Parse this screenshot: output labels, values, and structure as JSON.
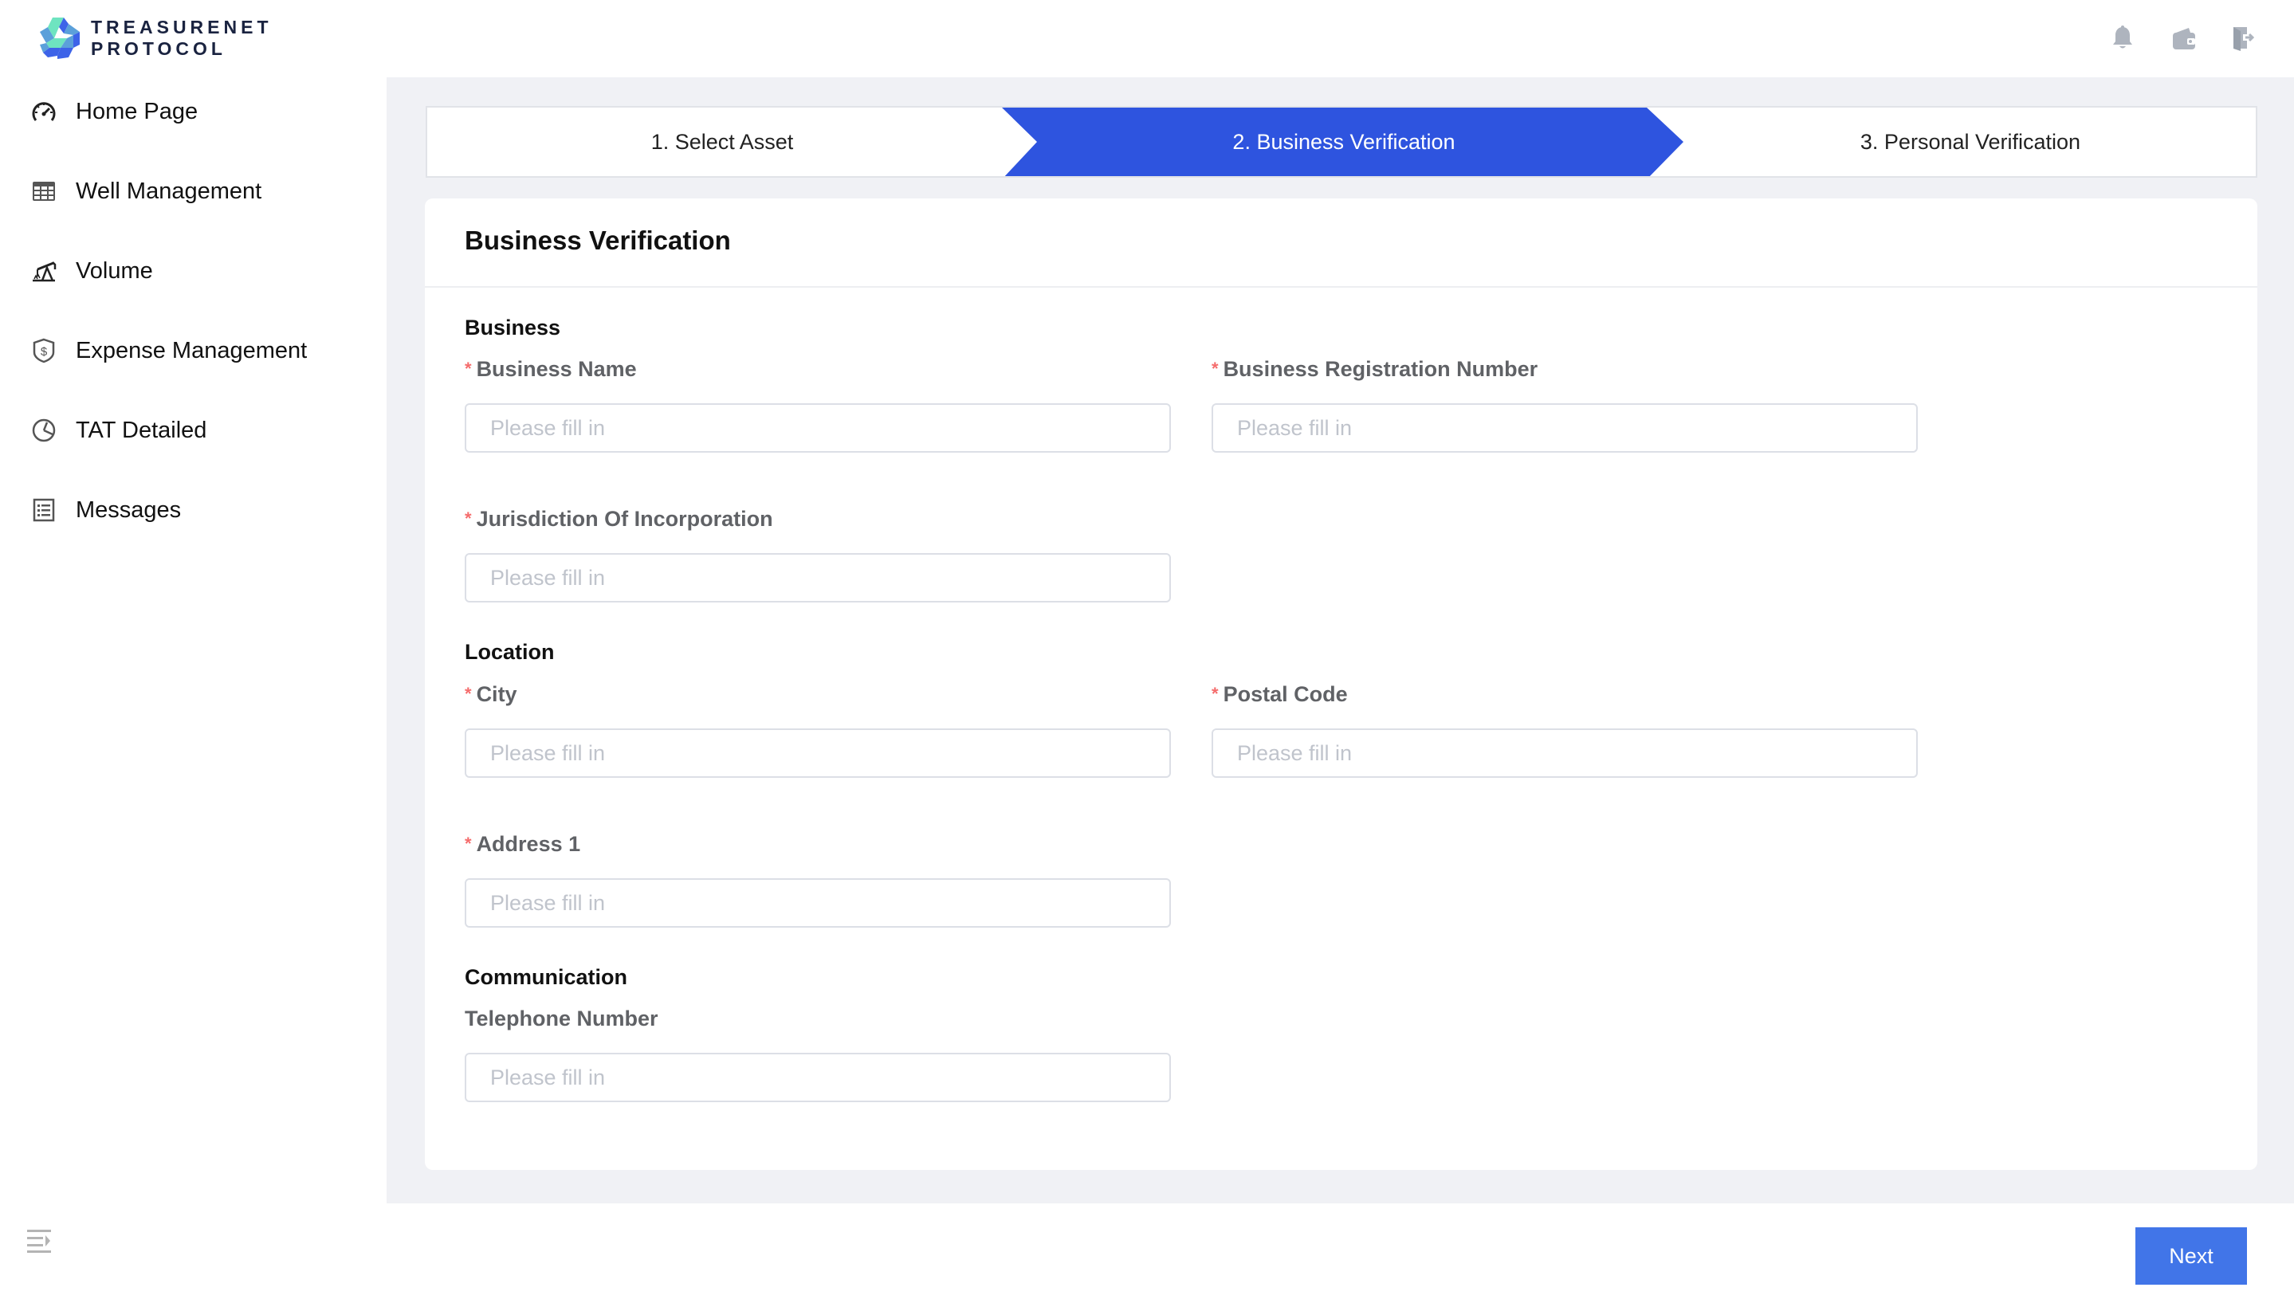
{
  "brand": {
    "line1": "TREASURENET",
    "line2": "PROTOCOL",
    "colors": {
      "teal": "#6EE4C0",
      "mid_blue": "#5BA0DA",
      "blue": "#3D63E8",
      "navy": "#1A2340"
    }
  },
  "header": {
    "icons": [
      {
        "name": "bell-icon"
      },
      {
        "name": "wallet-icon"
      },
      {
        "name": "logout-icon"
      }
    ]
  },
  "sidebar": {
    "items": [
      {
        "label": "Home Page",
        "icon": "dashboard-gauge-icon"
      },
      {
        "label": "Well Management",
        "icon": "table-grid-icon"
      },
      {
        "label": "Volume",
        "icon": "oil-pump-icon"
      },
      {
        "label": "Expense Management",
        "icon": "shield-dollar-icon"
      },
      {
        "label": "TAT Detailed",
        "icon": "pie-clock-icon"
      },
      {
        "label": "Messages",
        "icon": "list-document-icon"
      }
    ],
    "collapse_icon": "collapse-menu-icon"
  },
  "steps": {
    "items": [
      {
        "label": "1. Select Asset",
        "active": false
      },
      {
        "label": "2. Business Verification",
        "active": true
      },
      {
        "label": "3. Personal Verification",
        "active": false
      }
    ],
    "active_color": "#2E54DF"
  },
  "form": {
    "title": "Business Verification",
    "sections": {
      "business": "Business",
      "location": "Location",
      "communication": "Communication"
    },
    "fields": {
      "business_name": {
        "label": "Business Name",
        "required": "*",
        "placeholder": "Please fill in",
        "value": ""
      },
      "business_registration_number": {
        "label": "Business Registration Number",
        "required": "*",
        "placeholder": "Please fill in",
        "value": ""
      },
      "jurisdiction": {
        "label": "Jurisdiction Of Incorporation",
        "required": "*",
        "placeholder": "Please fill in",
        "value": ""
      },
      "city": {
        "label": "City",
        "required": "*",
        "placeholder": "Please fill in",
        "value": ""
      },
      "postal_code": {
        "label": "Postal Code",
        "required": "*",
        "placeholder": "Please fill in",
        "value": ""
      },
      "address1": {
        "label": "Address 1",
        "required": "*",
        "placeholder": "Please fill in",
        "value": ""
      },
      "telephone": {
        "label": "Telephone Number",
        "placeholder": "Please fill in",
        "value": ""
      }
    }
  },
  "footer": {
    "next_label": "Next",
    "next_color": "#4175E8"
  }
}
